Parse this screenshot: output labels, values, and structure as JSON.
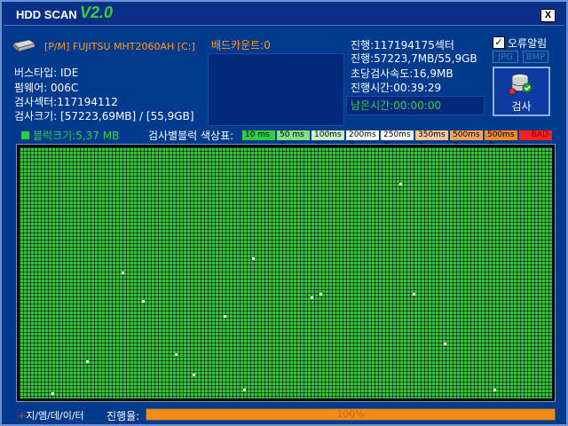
{
  "app": {
    "title": "HDD SCAN",
    "version": "V2.0",
    "close_label": "X"
  },
  "drive": {
    "label": "[P/M] FUJITSU MHT2060AH [C:]"
  },
  "info": {
    "bus_type": "버스타입: IDE",
    "firmware": "펌웨어: 006C",
    "scan_sectors": "검사섹터:117194112",
    "scan_size": "검사크기: [57223,69MB] / [55,9GB]"
  },
  "bad_count": "배드카운트:0",
  "progress_info": {
    "sectors": "진행:117194175섹터",
    "size": "진행:57223,7MB/55,9GB",
    "speed": "초당검사속도:16,9MB",
    "elapsed": "진행시간:00:39:29",
    "remaining": "남은시간:00:00:00"
  },
  "options": {
    "error_alert_label": "오류알림",
    "error_alert_checked": "✓",
    "jpg_label": "JPG",
    "bmp_label": "BMP"
  },
  "scan_button": {
    "label": "검사",
    "icon": "database-scan-icon"
  },
  "legend": {
    "block_size": "블럭크기:5,37 MB",
    "title": "검사별블럭 색상표:",
    "items": [
      {
        "label": "10 ms",
        "color": "#2ecc40"
      },
      {
        "label": "50 ms >",
        "color": "#7ee07e"
      },
      {
        "label": "100ms >",
        "color": "#c9f1c9"
      },
      {
        "label": "200ms >",
        "color": "#ffffff"
      },
      {
        "label": "250ms >",
        "color": "#ffffff"
      },
      {
        "label": "350ms >",
        "color": "#f7c79f"
      },
      {
        "label": "500ms >",
        "color": "#f4a45a"
      },
      {
        "label": "500ms <",
        "color": "#f08a2a"
      },
      {
        "label": "BAD",
        "color": "#ff2020"
      }
    ]
  },
  "status": {
    "brand_plus": "+",
    "brand": "지/엠/데/이/터",
    "progress_label": "진행율:",
    "progress_text": "100%",
    "progress_value": 1.0
  },
  "colors": {
    "window_bg": "#003a8c",
    "accent_orange": "#ff9a1f",
    "accent_green": "#3bd04a",
    "block_ok": "#37c23f"
  }
}
